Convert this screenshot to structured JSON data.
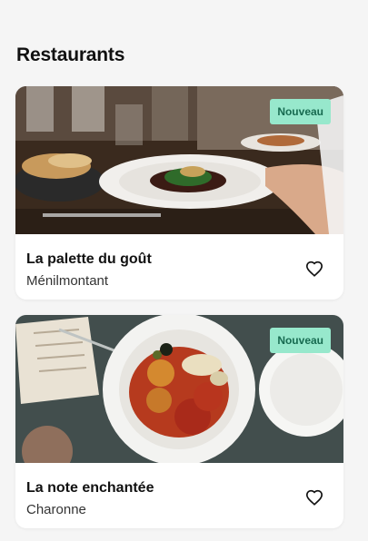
{
  "page": {
    "title": "Restaurants"
  },
  "restaurants": [
    {
      "name": "La palette du goût",
      "area": "Ménilmontant",
      "badge": "Nouveau"
    },
    {
      "name": "La note enchantée",
      "area": "Charonne",
      "badge": "Nouveau"
    }
  ],
  "icons": {
    "favorite": "heart-outline-icon"
  },
  "colors": {
    "badge_bg": "#97e8cc",
    "badge_text": "#176a50",
    "background": "#f5f5f5"
  }
}
